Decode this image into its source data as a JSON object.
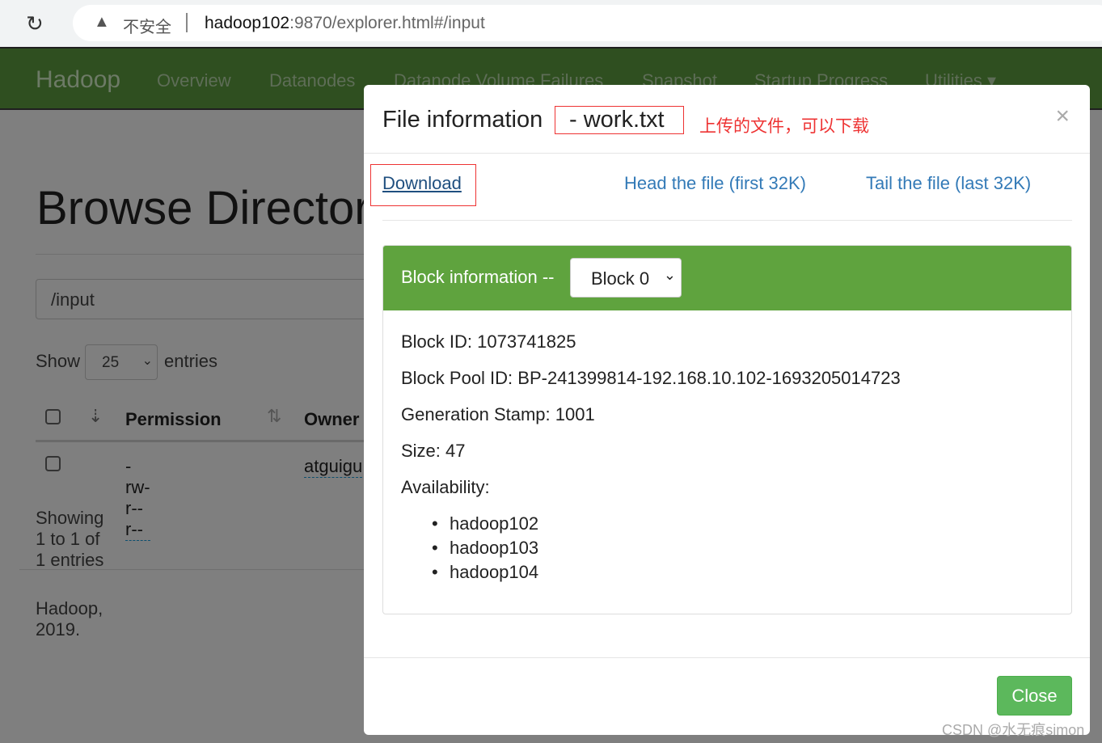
{
  "browser": {
    "warning_icon": "warning-triangle-icon",
    "insecure_label": "不安全",
    "url_host": "hadoop102",
    "url_rest": ":9870/explorer.html#/input"
  },
  "navbar": {
    "brand": "Hadoop",
    "items": [
      "Overview",
      "Datanodes",
      "Datanode Volume Failures",
      "Snapshot",
      "Startup Progress",
      "Utilities ▾"
    ]
  },
  "page": {
    "title": "Browse Directory",
    "path": "/input",
    "show_label": "Show",
    "entries_value": "25",
    "entries_label": "entries",
    "columns": [
      "Permission",
      "Owner"
    ],
    "row": {
      "permission": "-rw-r--r--",
      "owner": "atguigu"
    },
    "showing": "Showing 1 to 1 of 1 entries",
    "footer": "Hadoop, 2019."
  },
  "modal": {
    "title": "File information",
    "file_name": "- work.txt",
    "annotation": "上传的文件，可以下载",
    "close_x": "×",
    "download": "Download",
    "head": "Head the file (first 32K)",
    "tail": "Tail the file (last 32K)",
    "block_label": "Block information --",
    "block_selected": "Block 0",
    "block_id": "Block ID: 1073741825",
    "block_pool": "Block Pool ID: BP-241399814-192.168.10.102-1693205014723",
    "gen_stamp": "Generation Stamp: 1001",
    "size": "Size: 47",
    "availability": "Availability:",
    "hosts": [
      "hadoop102",
      "hadoop103",
      "hadoop104"
    ],
    "close_button": "Close"
  },
  "watermark": "CSDN @水无痕simon",
  "colors": {
    "navbar": "#2f4f20",
    "panel_header": "#5fa33e",
    "link": "#337ab7",
    "close_button": "#5cb85c",
    "annotation": "#ee3333"
  }
}
